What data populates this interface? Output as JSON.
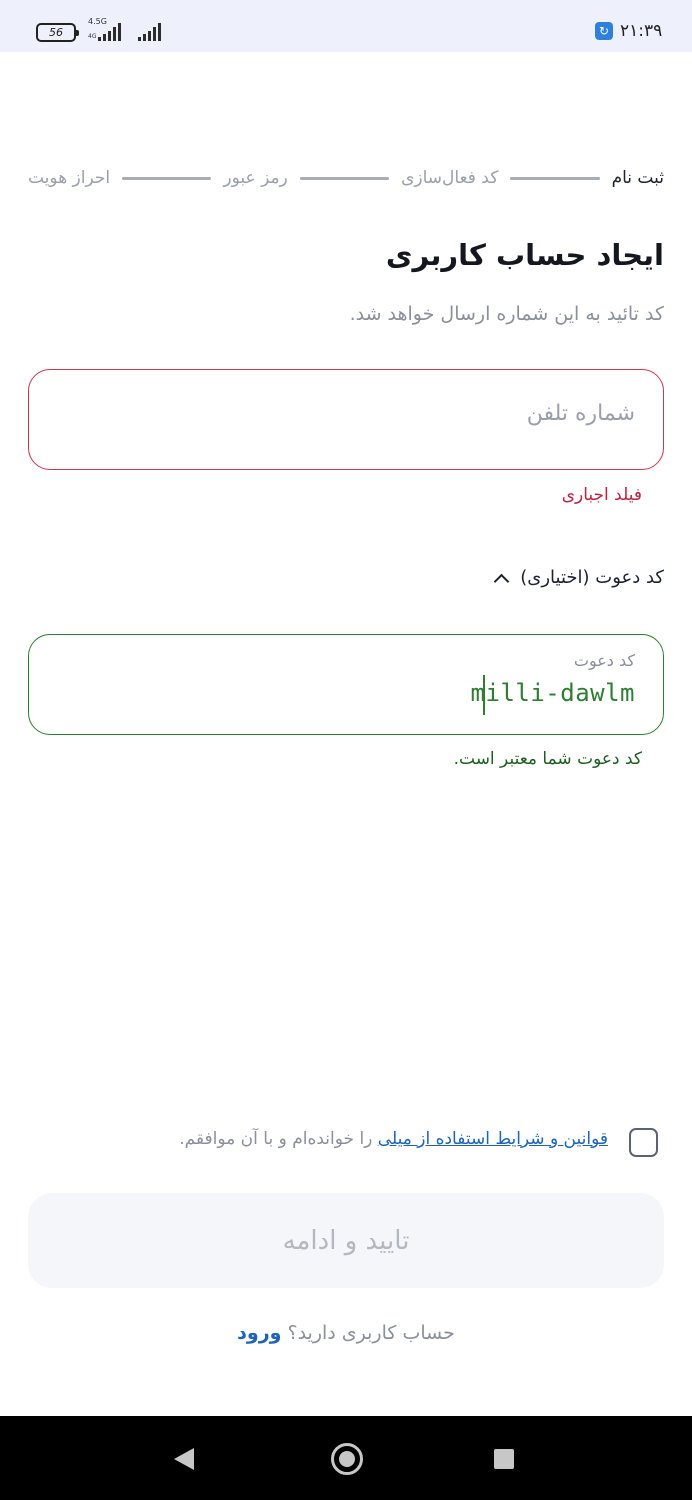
{
  "status_bar": {
    "battery": "56",
    "network": "4.5G",
    "network_sub": "4G",
    "clock": "۲۱:۳۹",
    "sync_icon": "sync-icon"
  },
  "stepper": {
    "steps": [
      "ثبت نام",
      "کد فعال‌سازی",
      "رمز عبور",
      "احراز هویت"
    ]
  },
  "header": {
    "title": "ایجاد حساب کاربری",
    "subtitle": "کد تائید به این شماره ارسال خواهد شد."
  },
  "phone": {
    "placeholder": "شماره تلفن",
    "error": "فیلد اجباری"
  },
  "invite": {
    "toggle_label": "کد دعوت (اختیاری)",
    "label": "کد دعوت",
    "value": "milli-dawlm",
    "success": "کد دعوت شما معتبر است."
  },
  "terms": {
    "link": "قوانین و شرایط استفاده از میلی",
    "text": " را خوانده‌ام و با آن موافقم."
  },
  "continue_button": "تایید و ادامه",
  "login": {
    "question": "حساب کاربری دارید؟ ",
    "link": "ورود"
  },
  "colors": {
    "error": "#c0223f",
    "success": "#2e7d32",
    "link": "#1d64b8"
  }
}
